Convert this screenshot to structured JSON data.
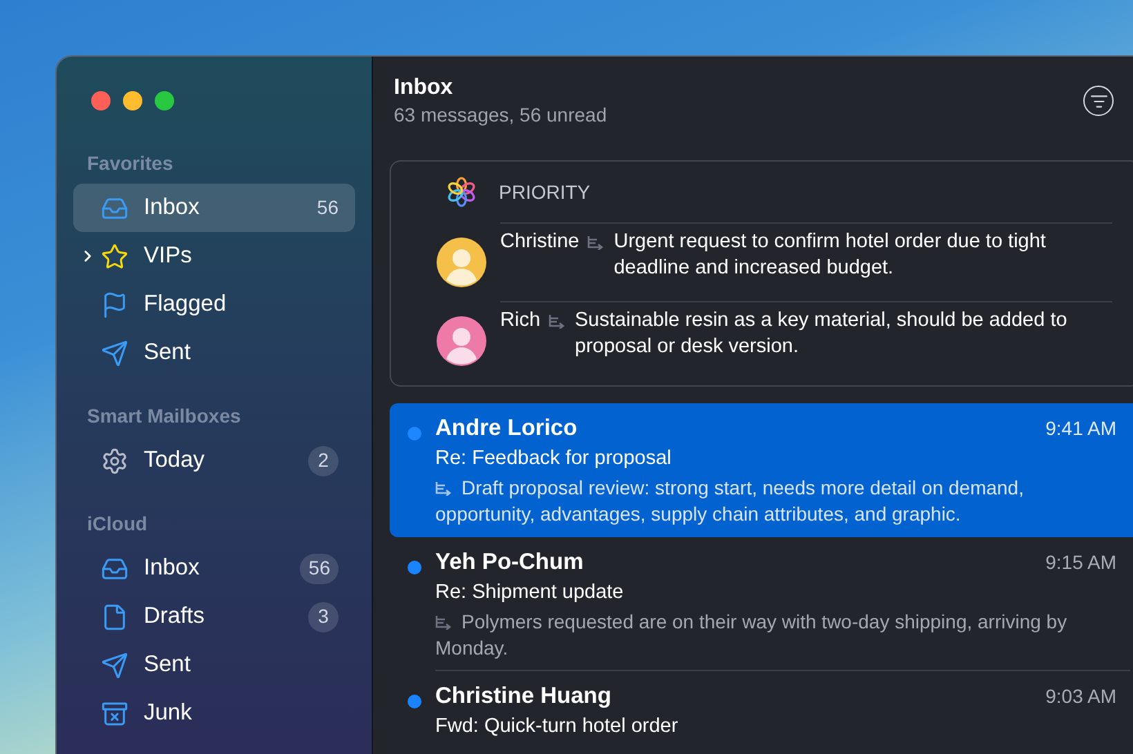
{
  "sidebar": {
    "sections": [
      {
        "title": "Favorites",
        "items": [
          {
            "kind": "inbox",
            "label": "Inbox",
            "count": "56",
            "selected": true,
            "expandable": false
          },
          {
            "kind": "star",
            "label": "VIPs",
            "selected": false,
            "expandable": true
          },
          {
            "kind": "flag",
            "label": "Flagged",
            "selected": false,
            "expandable": false
          },
          {
            "kind": "sent",
            "label": "Sent",
            "selected": false,
            "expandable": false
          }
        ]
      },
      {
        "title": "Smart Mailboxes",
        "items": [
          {
            "kind": "gear",
            "label": "Today",
            "count": "2",
            "selected": false,
            "expandable": false
          }
        ]
      },
      {
        "title": "iCloud",
        "items": [
          {
            "kind": "inbox",
            "label": "Inbox",
            "count": "56",
            "selected": false,
            "expandable": false
          },
          {
            "kind": "draft",
            "label": "Drafts",
            "count": "3",
            "selected": false,
            "expandable": false
          },
          {
            "kind": "sent",
            "label": "Sent",
            "selected": false,
            "expandable": false
          },
          {
            "kind": "junk",
            "label": "Junk",
            "selected": false,
            "expandable": false
          }
        ]
      }
    ]
  },
  "header": {
    "title": "Inbox",
    "subtitle": "63 messages, 56 unread"
  },
  "priority": {
    "title": "PRIORITY",
    "items": [
      {
        "sender": "Christine",
        "summary": "Urgent request to confirm hotel order due to tight deadline and increased budget.",
        "color": "#f5c04a"
      },
      {
        "sender": "Rich",
        "summary": "Sustainable resin as a key material, should be added to proposal or desk version.",
        "color": "#ee7aa8"
      }
    ]
  },
  "messages": [
    {
      "sender": "Andre Lorico",
      "time": "9:41 AM",
      "subject": "Re: Feedback for proposal",
      "preview": "Draft proposal review: strong start, needs more detail on demand, opportunity, advantages, supply chain attributes, and graphic.",
      "unread": true,
      "selected": true
    },
    {
      "sender": "Yeh Po-Chum",
      "time": "9:15 AM",
      "subject": "Re: Shipment update",
      "preview": "Polymers requested are on their way with two-day shipping, arriving by Monday.",
      "unread": true,
      "selected": false
    },
    {
      "sender": "Christine Huang",
      "time": "9:03 AM",
      "subject": "Fwd: Quick-turn hotel order",
      "unread": true,
      "selected": false
    }
  ]
}
